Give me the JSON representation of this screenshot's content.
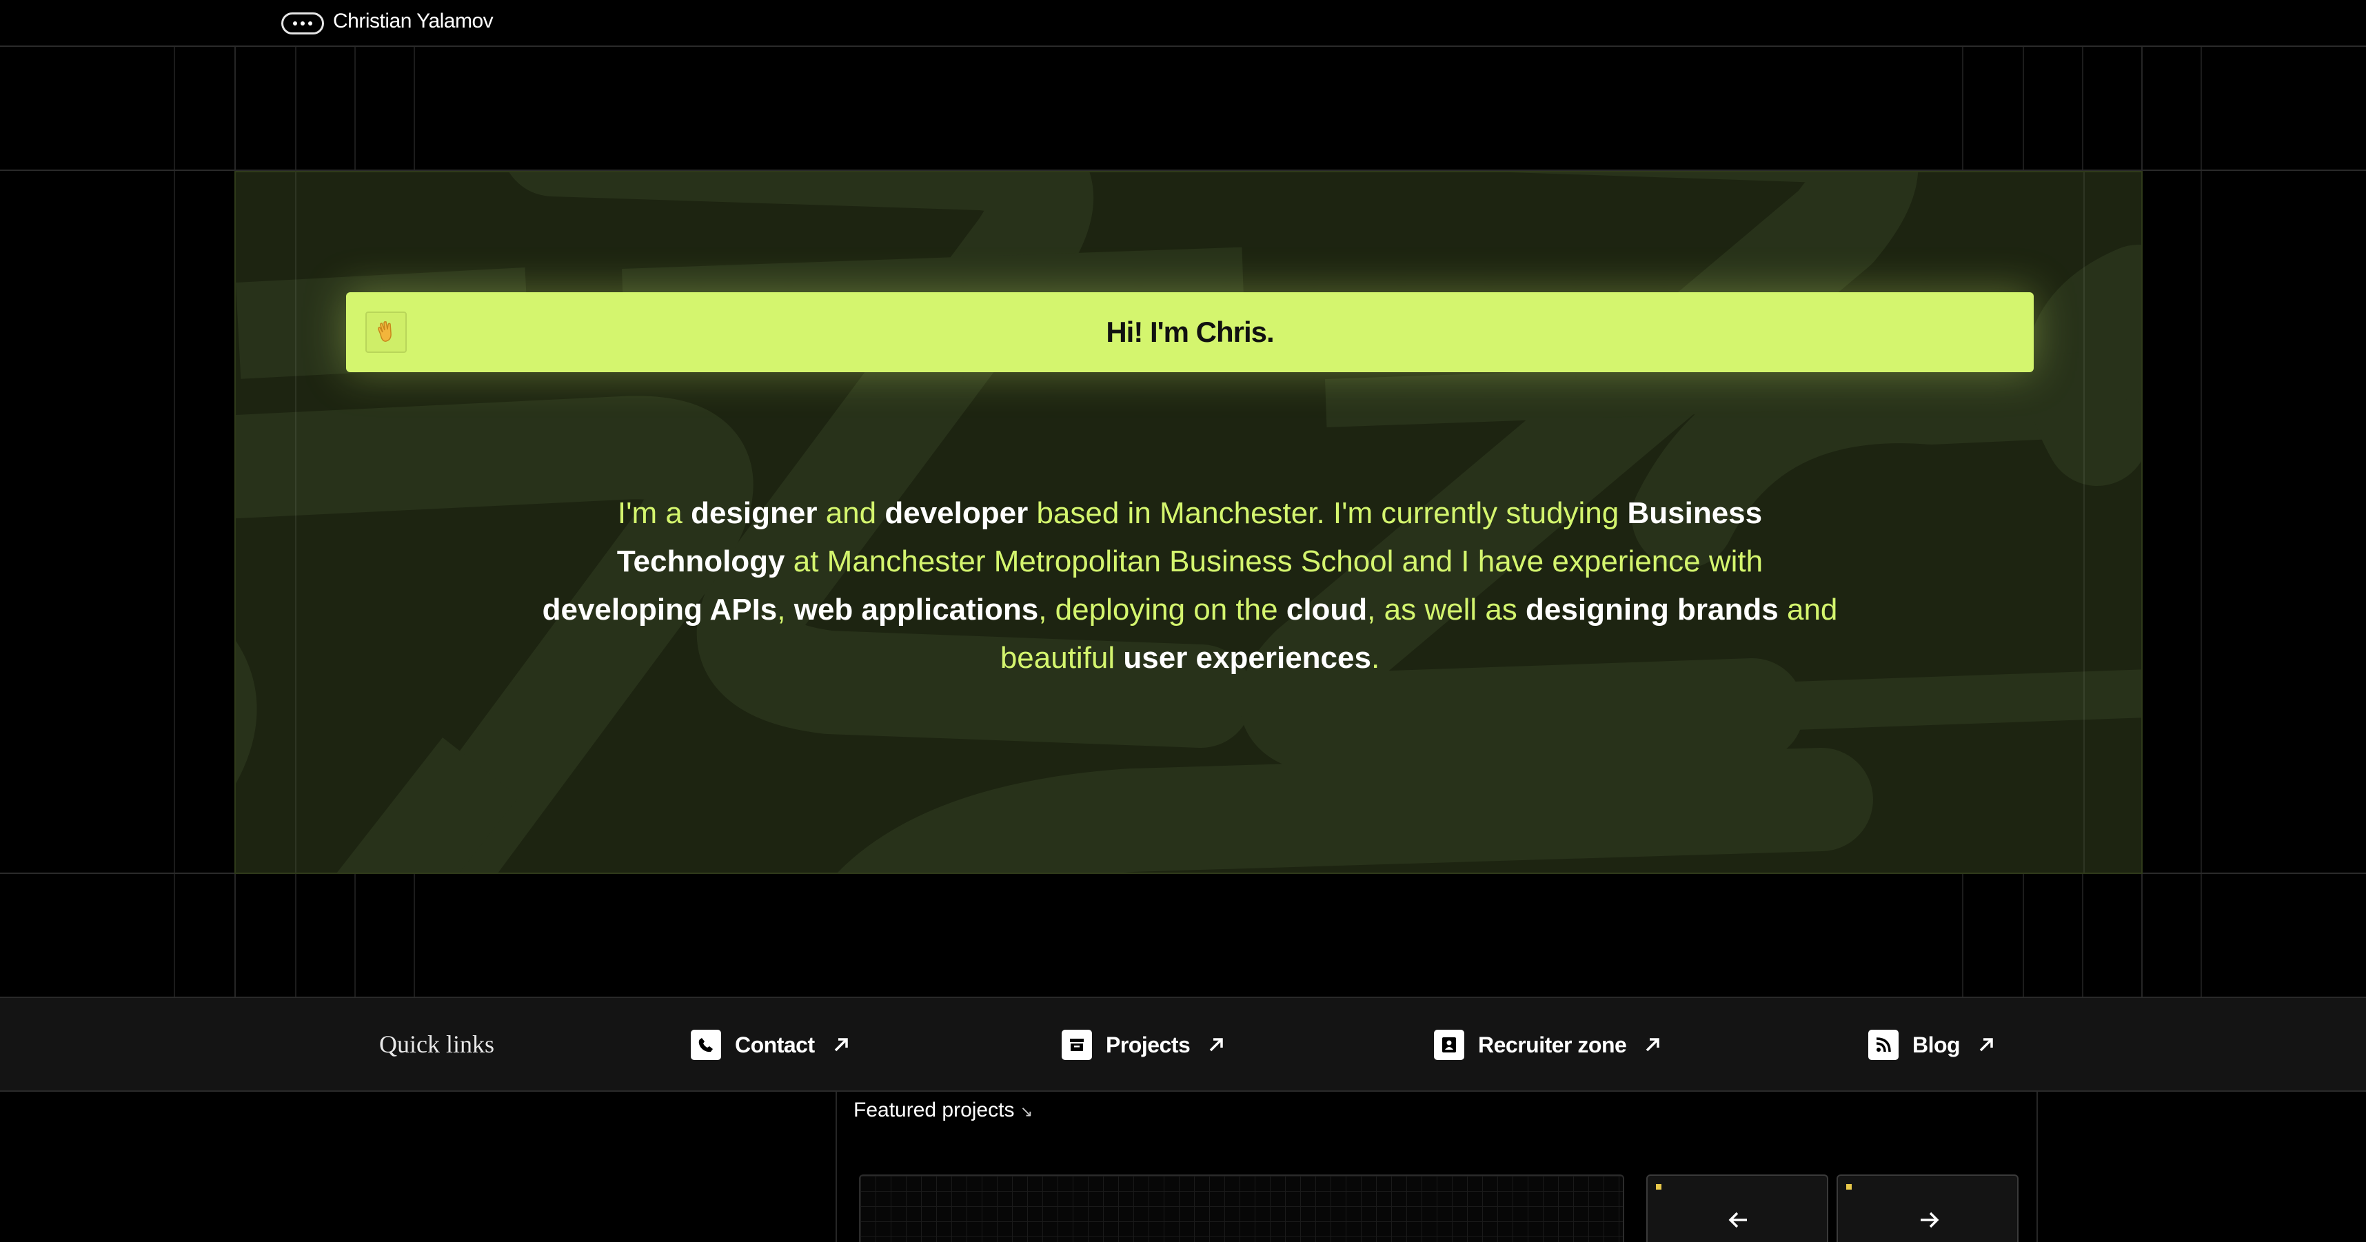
{
  "header": {
    "brand": "Christian Yalamov",
    "menu_icon": "more-dots-icon"
  },
  "hero": {
    "greeting": "Hi! I'm Chris.",
    "greeting_icon": "waving-hand-icon",
    "intro": [
      {
        "t": "I'm a ",
        "em": false
      },
      {
        "t": "designer",
        "em": true
      },
      {
        "t": " and ",
        "em": false
      },
      {
        "t": "developer",
        "em": true
      },
      {
        "t": " based in Manchester. I'm currently studying ",
        "em": false
      },
      {
        "t": "Business Technology",
        "em": true
      },
      {
        "t": " at Manchester Metropolitan Business School and I have experience with ",
        "em": false
      },
      {
        "t": "developing APIs",
        "em": true
      },
      {
        "t": ", ",
        "em": false
      },
      {
        "t": "web applications",
        "em": true
      },
      {
        "t": ", deploying on the ",
        "em": false
      },
      {
        "t": "cloud",
        "em": true
      },
      {
        "t": ", as well as ",
        "em": false
      },
      {
        "t": "designing brands",
        "em": true
      },
      {
        "t": " and beautiful ",
        "em": false
      },
      {
        "t": "user experiences",
        "em": true
      },
      {
        "t": ".",
        "em": false
      }
    ]
  },
  "quick_links": {
    "title": "Quick links",
    "items": [
      {
        "label": "Contact",
        "icon": "phone-icon"
      },
      {
        "label": "Projects",
        "icon": "archive-box-icon"
      },
      {
        "label": "Recruiter zone",
        "icon": "id-badge-icon"
      },
      {
        "label": "Blog",
        "icon": "rss-icon"
      }
    ]
  },
  "featured": {
    "title": "Featured projects",
    "title_arrow": "↘",
    "prev_icon": "arrow-left-icon",
    "next_icon": "arrow-right-icon"
  },
  "colors": {
    "accent": "#d4f56e",
    "hero_bg": "#1d2411",
    "page_bg": "#000000",
    "bar_bg": "#141414"
  }
}
